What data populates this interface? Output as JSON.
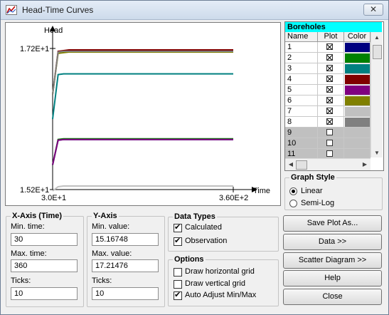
{
  "window": {
    "title": "Head-Time Curves",
    "close_glyph": "✕"
  },
  "plot": {
    "y_label": "Head",
    "x_label": "Time",
    "y_top_tick": "1.72E+1",
    "y_bottom_tick": "1.52E+1",
    "x_left_tick": "3.0E+1",
    "x_right_tick": "3.60E+2"
  },
  "chart_data": {
    "type": "line",
    "xlabel": "Time",
    "ylabel": "Head",
    "x_tick_labels": [
      "3.0E+1",
      "3.60E+2"
    ],
    "y_tick_labels": [
      "1.52E+1",
      "1.72E+1"
    ],
    "xlim": [
      30,
      360
    ],
    "ylim": [
      15.16748,
      17.21476
    ],
    "x": [
      30,
      40,
      50,
      60,
      360
    ],
    "series": [
      {
        "color": "#000080",
        "values": [
          15.55,
          15.9,
          15.91,
          15.91,
          15.91
        ]
      },
      {
        "color": "#008000",
        "values": [
          15.55,
          15.91,
          15.92,
          15.92,
          15.92
        ]
      },
      {
        "color": "#008080",
        "values": [
          16.2,
          16.83,
          16.84,
          16.84,
          16.84
        ]
      },
      {
        "color": "#800000",
        "values": [
          16.55,
          17.16,
          17.17,
          17.18,
          17.18
        ]
      },
      {
        "color": "#800080",
        "values": [
          15.55,
          15.9,
          15.91,
          15.91,
          15.91
        ]
      },
      {
        "color": "#808000",
        "values": [
          16.55,
          17.13,
          17.14,
          17.15,
          17.15
        ]
      },
      {
        "color": "#c0c0c0",
        "values": [
          15.18,
          15.24,
          15.25,
          15.25,
          15.25
        ]
      },
      {
        "color": "#808080",
        "values": [
          16.55,
          17.15,
          17.16,
          17.16,
          17.16
        ]
      }
    ]
  },
  "boreholes": {
    "title": "Boreholes",
    "headers": [
      "Name",
      "Plot",
      "Color"
    ],
    "rows": [
      {
        "name": "1",
        "checked": true,
        "color": "#000080"
      },
      {
        "name": "2",
        "checked": true,
        "color": "#008000"
      },
      {
        "name": "3",
        "checked": true,
        "color": "#008080"
      },
      {
        "name": "4",
        "checked": true,
        "color": "#800000"
      },
      {
        "name": "5",
        "checked": true,
        "color": "#800080"
      },
      {
        "name": "6",
        "checked": true,
        "color": "#808000"
      },
      {
        "name": "7",
        "checked": true,
        "color": "#c0c0c0"
      },
      {
        "name": "8",
        "checked": true,
        "color": "#808080"
      },
      {
        "name": "9",
        "checked": false,
        "color": ""
      },
      {
        "name": "10",
        "checked": false,
        "color": ""
      },
      {
        "name": "11",
        "checked": false,
        "color": ""
      }
    ]
  },
  "graph_style": {
    "title": "Graph Style",
    "linear": "Linear",
    "semilog": "Semi-Log",
    "selected": "Linear"
  },
  "x_axis": {
    "title": "X-Axis (Time)",
    "min_label": "Min. time:",
    "min_value": "30",
    "max_label": "Max. time:",
    "max_value": "360",
    "ticks_label": "Ticks:",
    "ticks_value": "10"
  },
  "y_axis": {
    "title": "Y-Axis",
    "min_label": "Min. value:",
    "min_value": "15.16748",
    "max_label": "Max. value:",
    "max_value": "17.21476",
    "ticks_label": "Ticks:",
    "ticks_value": "10"
  },
  "data_types": {
    "title": "Data Types",
    "calculated": "Calculated",
    "calculated_checked": true,
    "observation": "Observation",
    "observation_checked": true
  },
  "options": {
    "title": "Options",
    "hgrid": "Draw horizontal grid",
    "hgrid_checked": false,
    "vgrid": "Draw vertical grid",
    "vgrid_checked": false,
    "auto": "Auto Adjust Min/Max",
    "auto_checked": true
  },
  "buttons": {
    "save_plot": "Save Plot As...",
    "data": "Data >>",
    "scatter": "Scatter Diagram >>",
    "help": "Help",
    "close": "Close"
  }
}
